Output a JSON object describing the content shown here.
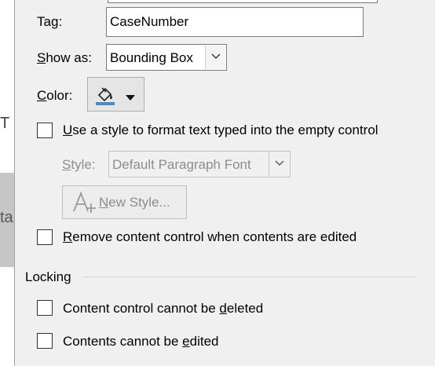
{
  "background": {
    "glyph_t": "T",
    "glyph_ta": "ta"
  },
  "tag": {
    "label_pre": "",
    "label_underline": "T",
    "label_mid": "a",
    "label_underline2": "g",
    "label_post": ":",
    "value": "CaseNumber"
  },
  "show_as": {
    "label_underline": "S",
    "label_post": "how as:",
    "value": "Bounding Box"
  },
  "color": {
    "label_underline": "C",
    "label_post": "olor:",
    "icon": "paint-bucket-icon",
    "accent": "#4a8ac9"
  },
  "use_style": {
    "label_underline": "U",
    "label_post": "se a style to format text typed into the empty control",
    "checked": false
  },
  "style": {
    "label_underline": "S",
    "label_post": "tyle:",
    "value": "Default Paragraph Font"
  },
  "new_style_button": {
    "icon": "new-style-icon",
    "label_underline": "N",
    "label_post": "ew Style..."
  },
  "remove_control": {
    "label_underline": "R",
    "label_post": "emove content control when contents are edited",
    "checked": false
  },
  "locking": {
    "heading": "Locking",
    "cannot_delete": {
      "label_pre": "Content control cannot be ",
      "label_underline": "d",
      "label_post": "eleted",
      "checked": false
    },
    "cannot_edit": {
      "label_pre": "Contents cannot be ",
      "label_underline": "e",
      "label_post": "dited",
      "checked": false
    }
  }
}
